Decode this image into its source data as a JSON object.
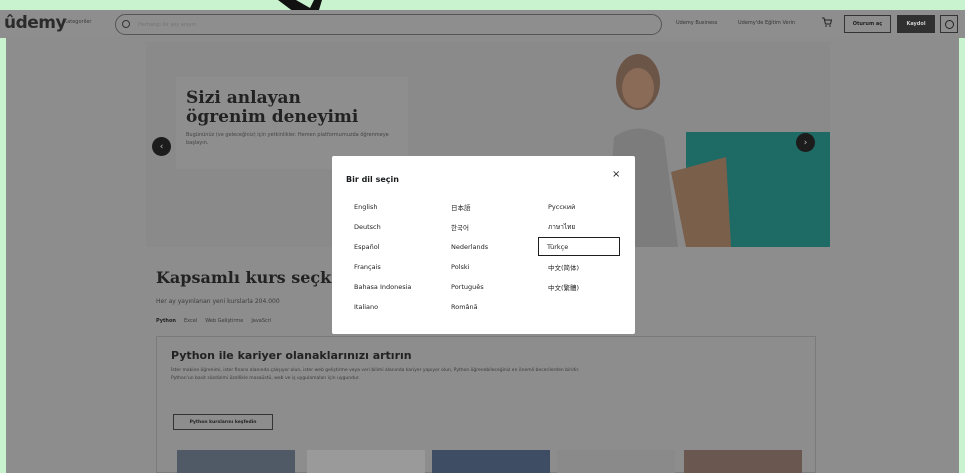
{
  "header": {
    "logo": "ûdemy",
    "categories": "Kategoriler",
    "search_placeholder": "Herhangi bir şey arayın",
    "link_business": "Udemy Business",
    "link_teach": "Udemy'de Eğitim Verin",
    "login": "Oturum aç",
    "signup": "Kaydol"
  },
  "hero": {
    "title": "Sizi anlayan ögrenim deneyimi",
    "subtitle": "Bugününüz (ve geleceğiniz) için yetkinlikler. Hemen platformumuzda öğrenmeye başlayın."
  },
  "courses": {
    "title": "Kapsamlı kurs seçkisi",
    "subtitle": "Her ay yayınlanan yeni kurslarla 204.000",
    "tabs": [
      "Python",
      "Excel",
      "Web Geliştirme",
      "JavaScri"
    ],
    "python_title": "Python ile kariyer olanaklarınızı artırın",
    "python_desc": "İster makine öğrenimi, ister finans alanında çalışıyor olun, ister web geliştirme veya veri bilimi alanında kariyer yapıyor olun, Python öğrenebileceğiniz en önemli becerilerden biridir. Python'un basit sözdizimi özellikle masaüstü, web ve iş uygulamaları için uygundur.",
    "python_button": "Python kurslarını keşfedin"
  },
  "modal": {
    "title": "Bir dil seçin",
    "close": "×",
    "languages": [
      [
        "English",
        "日本語",
        "Русский"
      ],
      [
        "Deutsch",
        "한국어",
        "ภาษาไทย"
      ],
      [
        "Español",
        "Nederlands",
        "Türkçe"
      ],
      [
        "Français",
        "Polski",
        "中文(简体)"
      ],
      [
        "Bahasa Indonesia",
        "Português",
        "中文(繁體)"
      ],
      [
        "Italiano",
        "Română",
        ""
      ]
    ],
    "selected": "Türkçe"
  }
}
